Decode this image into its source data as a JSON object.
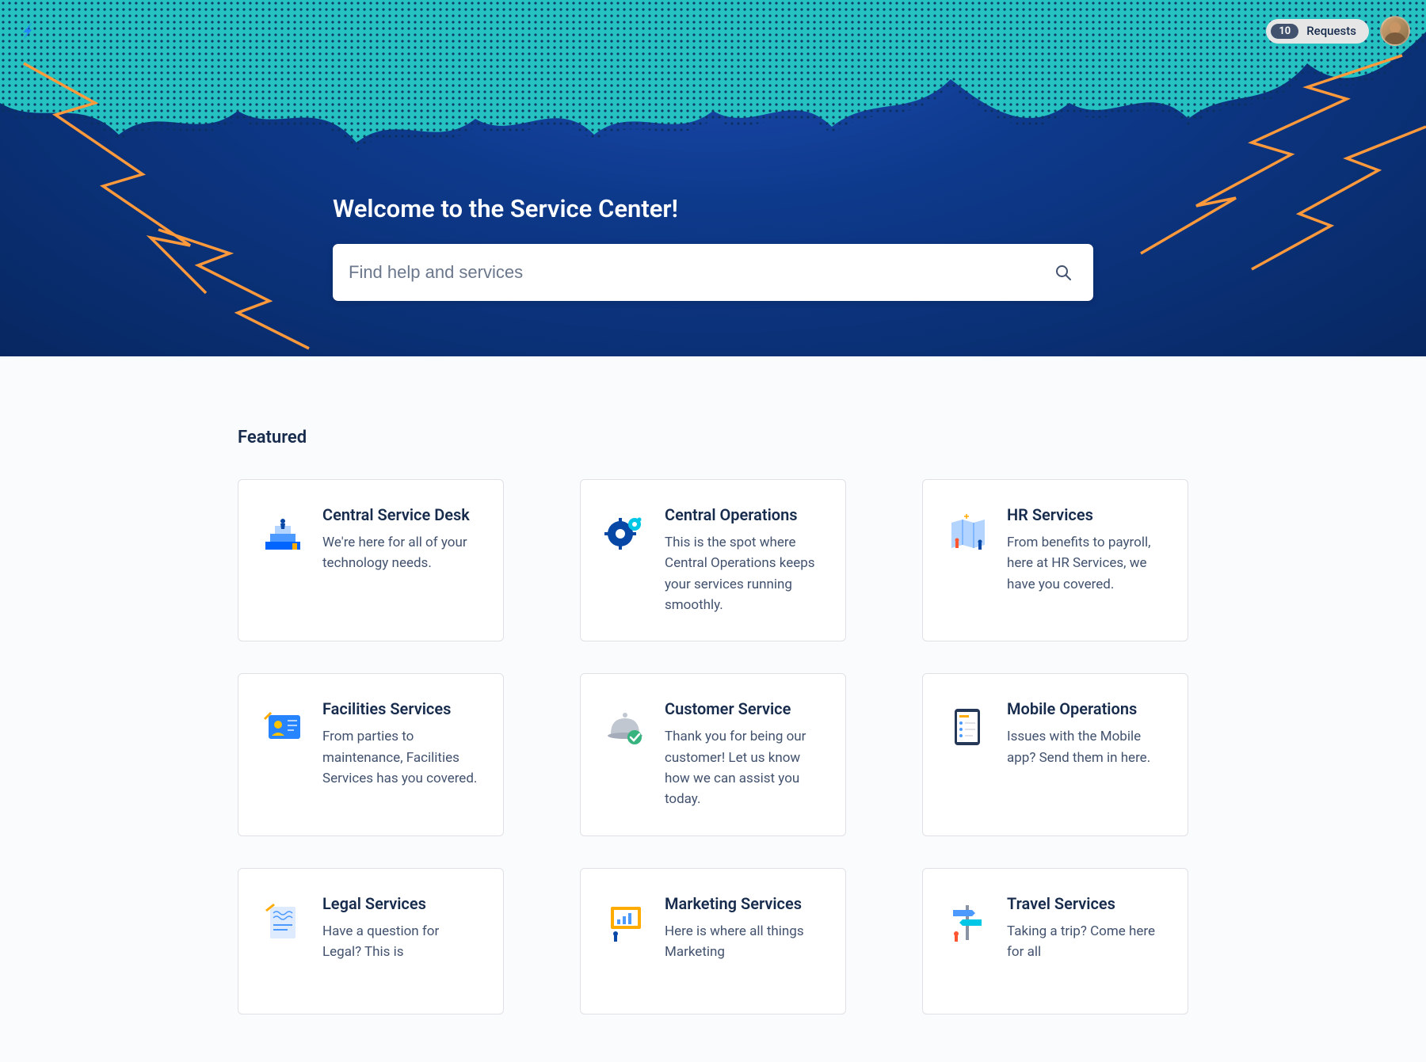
{
  "topbar": {
    "requests_count": "10",
    "requests_label": "Requests"
  },
  "hero": {
    "title": "Welcome to the Service Center!",
    "search_placeholder": "Find help and services"
  },
  "featured": {
    "heading": "Featured",
    "cards": [
      {
        "title": "Central Service Desk",
        "desc": "We're here for all of your technology needs."
      },
      {
        "title": "Central Operations",
        "desc": "This is the spot where Central Operations keeps your services running smoothly."
      },
      {
        "title": "HR Services",
        "desc": "From benefits to payroll, here at HR Services, we have you covered."
      },
      {
        "title": "Facilities Services",
        "desc": "From parties to maintenance, Facilities Services has you covered."
      },
      {
        "title": "Customer Service",
        "desc": "Thank you for being our customer! Let us know how we can assist you today."
      },
      {
        "title": "Mobile Operations",
        "desc": "Issues with the Mobile app? Send them in here."
      },
      {
        "title": "Legal Services",
        "desc": "Have a question for Legal? This is"
      },
      {
        "title": "Marketing Services",
        "desc": "Here is where all things Marketing"
      },
      {
        "title": "Travel Services",
        "desc": "Taking a trip? Come here for all"
      }
    ]
  }
}
